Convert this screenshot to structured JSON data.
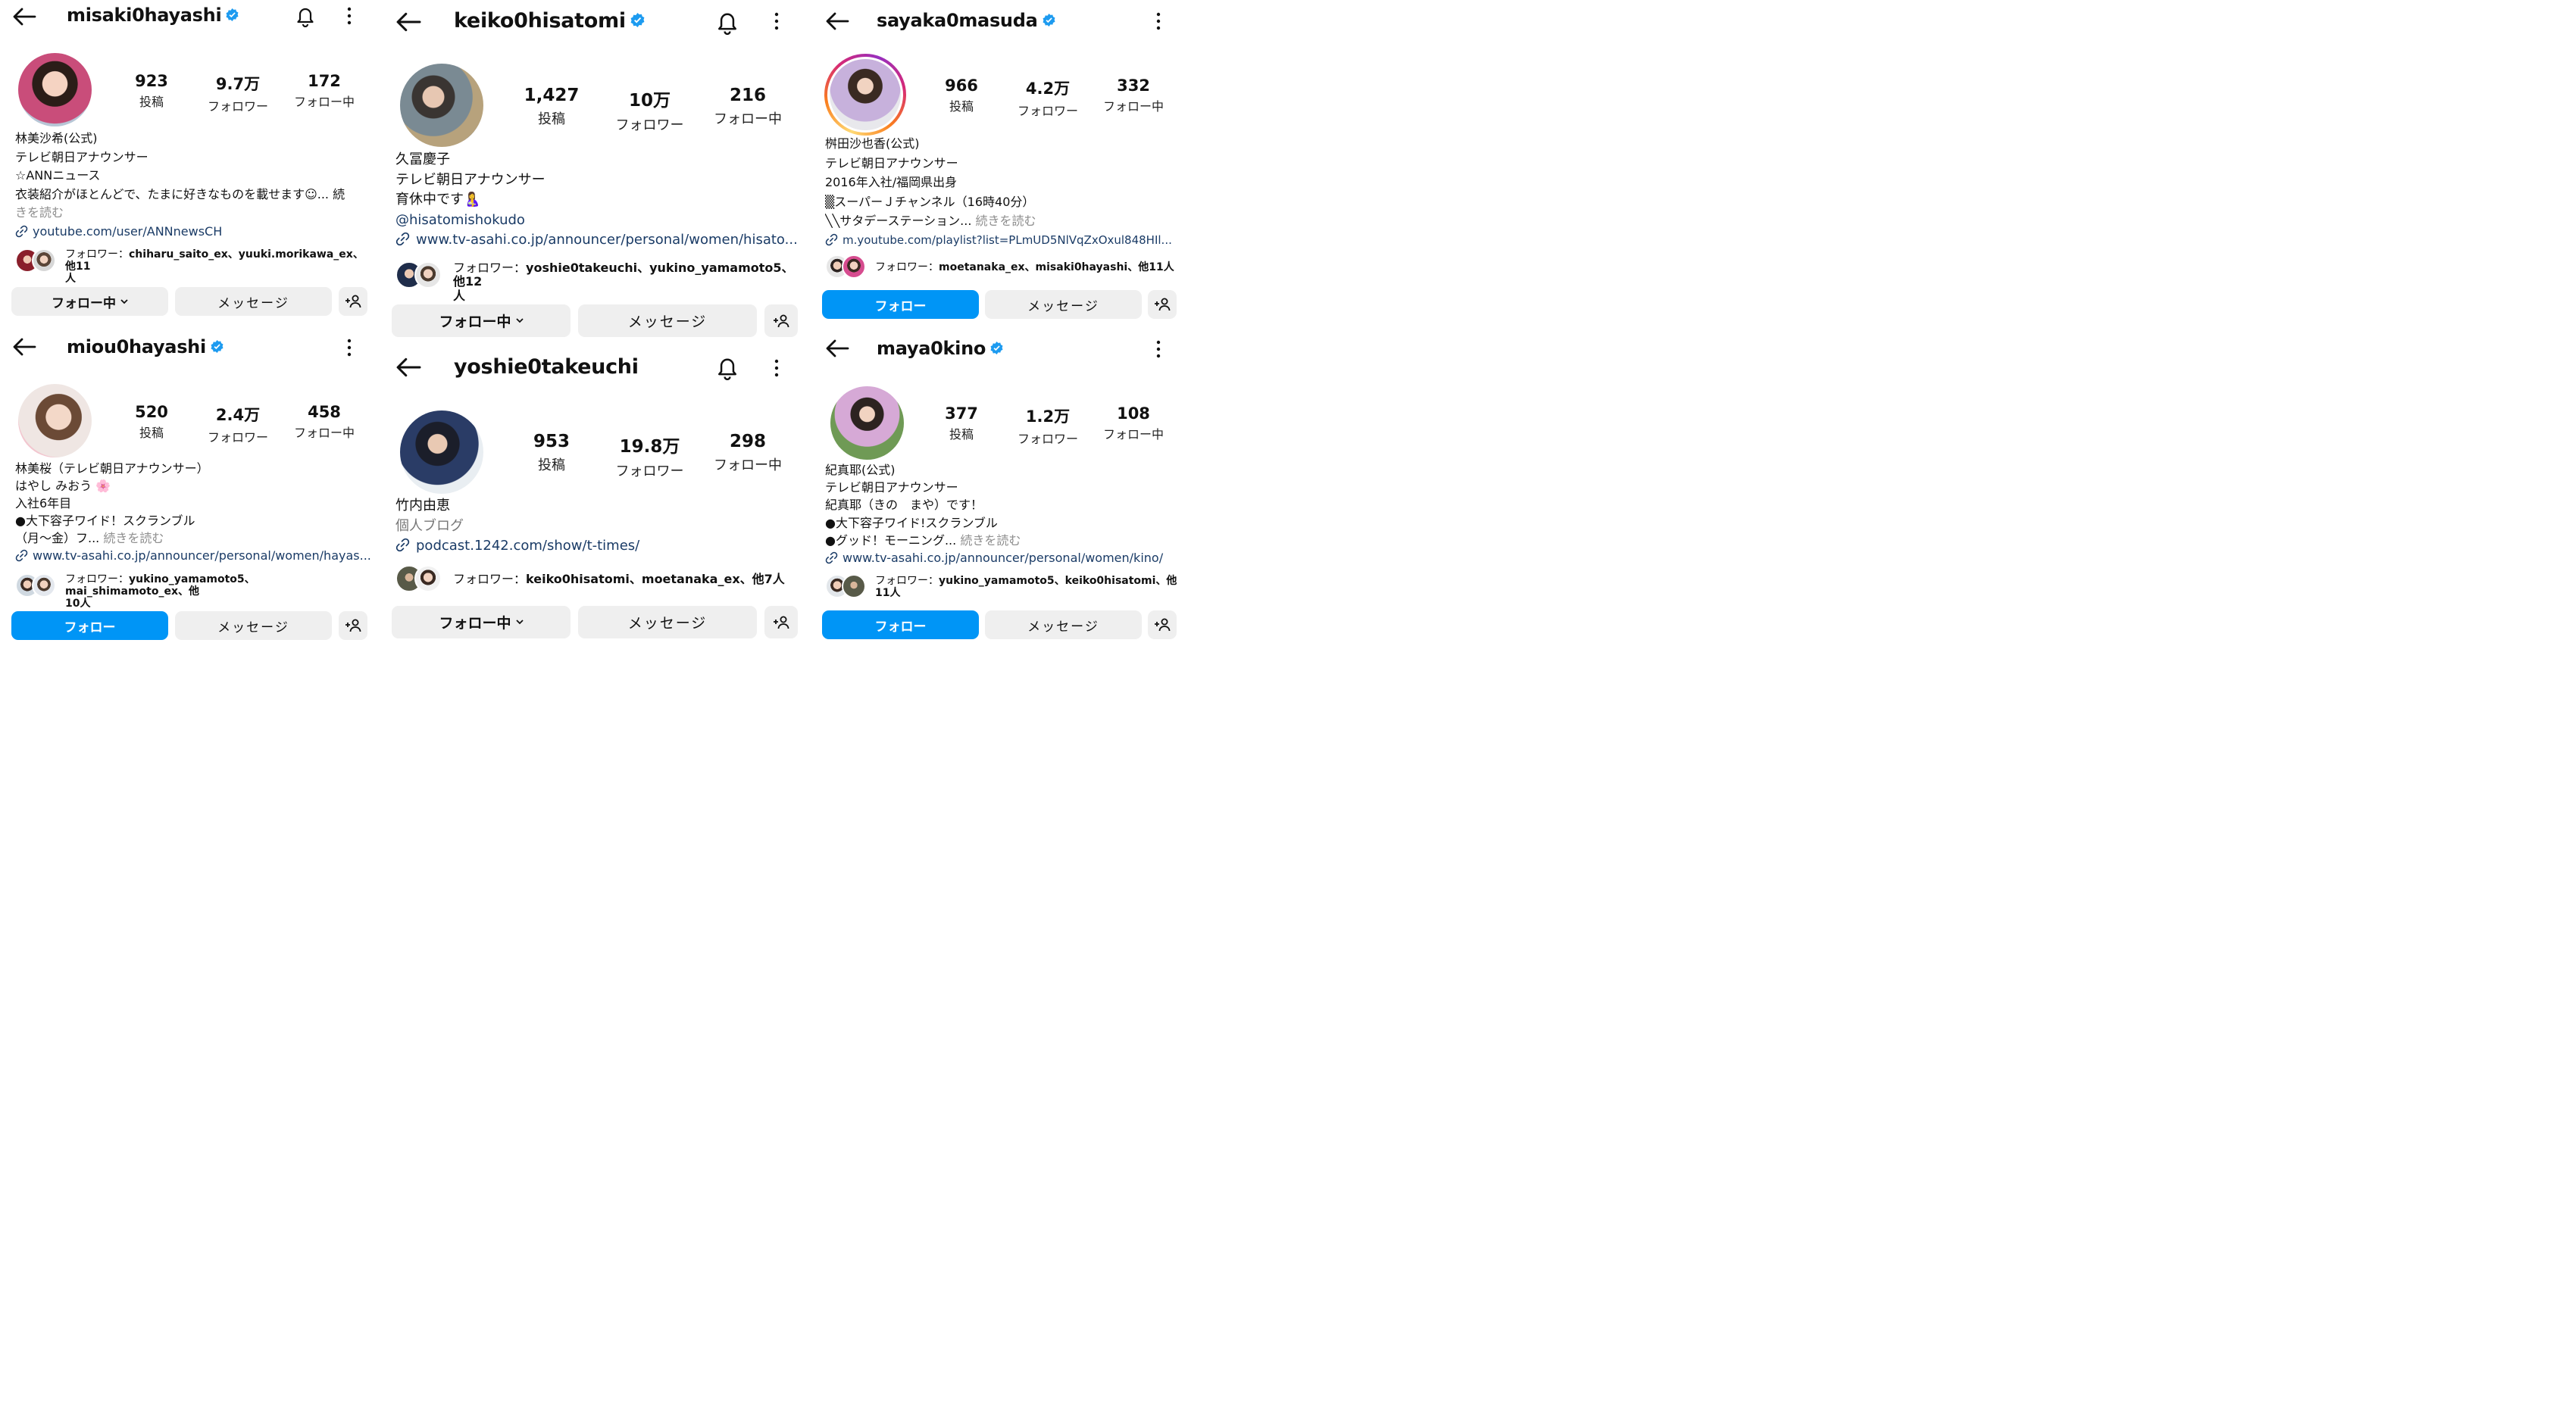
{
  "labels": {
    "posts": "投稿",
    "followers": "フォロワー",
    "following": "フォロー中",
    "following_btn": "フォロー中",
    "follow_btn": "フォロー",
    "message_btn": "メッセージ",
    "followed_by_prefix": "フォロワー：",
    "read_more": "続きを読む"
  },
  "profiles": {
    "misaki": {
      "username": "misaki0hayashi",
      "posts": "923",
      "followers": "9.7万",
      "following": "172",
      "bio": [
        "林美沙希(公式)",
        "テレビ朝日アナウンサー",
        "☆ANNニュース",
        "衣装紹介がほとんどで、たまに好きなものを載せます☺... 続",
        "きを読む"
      ],
      "link": "youtube.com/user/ANNnewsCH",
      "followed_by": "chiharu_saito_ex、yuuki.morikawa_ex、他11",
      "followed_by_2": "人",
      "button": "フォロー中"
    },
    "miou": {
      "username": "miou0hayashi",
      "posts": "520",
      "followers": "2.4万",
      "following": "458",
      "bio": [
        "林美桜（テレビ朝日アナウンサー）",
        "はやし みおう 🌸",
        "入社6年目",
        "●大下容子ワイド！スクランブル",
        "（月〜金）フ..."
      ],
      "link": "www.tv-asahi.co.jp/announcer/personal/women/hayas...",
      "followed_by": "yukino_yamamoto5、mai_shimamoto_ex、他",
      "followed_by_2": "10人",
      "button": "フォロー"
    },
    "keiko": {
      "username": "keiko0hisatomi",
      "posts": "1,427",
      "followers": "10万",
      "following": "216",
      "bio": [
        "久冨慶子",
        "テレビ朝日アナウンサー",
        "育休中です🤱"
      ],
      "mention": "@hisatomishokudo",
      "link": "www.tv-asahi.co.jp/announcer/personal/women/hisato...",
      "followed_by": "yoshie0takeuchi、yukino_yamamoto5、他12",
      "followed_by_2": "人",
      "button": "フォロー中"
    },
    "yoshie": {
      "username": "yoshie0takeuchi",
      "posts": "953",
      "followers": "19.8万",
      "following": "298",
      "bio": [
        "竹内由恵"
      ],
      "category": "個人ブログ",
      "link": "podcast.1242.com/show/t-times/",
      "followed_by": "keiko0hisatomi、moetanaka_ex、他7人",
      "button": "フォロー中"
    },
    "sayaka": {
      "username": "sayaka0masuda",
      "posts": "966",
      "followers": "4.2万",
      "following": "332",
      "bio": [
        "桝田沙也香(公式)",
        "テレビ朝日アナウンサー",
        "2016年入社/福岡県出身",
        "▒スーパーＪチャンネル（16時40分）",
        "╲╲サタデーステーション..."
      ],
      "link": "m.youtube.com/playlist?list=PLmUD5NlVqZxOxul848HIl...",
      "followed_by": "moetanaka_ex、misaki0hayashi、他11人",
      "button": "フォロー"
    },
    "maya": {
      "username": "maya0kino",
      "posts": "377",
      "followers": "1.2万",
      "following": "108",
      "bio": [
        "紀真耶(公式)",
        "テレビ朝日アナウンサー",
        "紀真耶（きの　まや）です！",
        "●大下容子ワイド!スクランブル",
        "●グッド！モーニング..."
      ],
      "link": "www.tv-asahi.co.jp/announcer/personal/women/kino/",
      "followed_by": "yukino_yamamoto5、keiko0hisatomi、他11人",
      "button": "フォロー"
    }
  },
  "colors": {
    "accent": "#0095f6",
    "verified": "#1d9bf0",
    "button_gray": "#efefef",
    "link": "#1a3b66"
  },
  "icons": [
    "back-arrow-icon",
    "verified-badge-icon",
    "bell-icon",
    "kebab-menu-icon",
    "chevron-down-icon",
    "add-user-icon",
    "link-icon"
  ]
}
